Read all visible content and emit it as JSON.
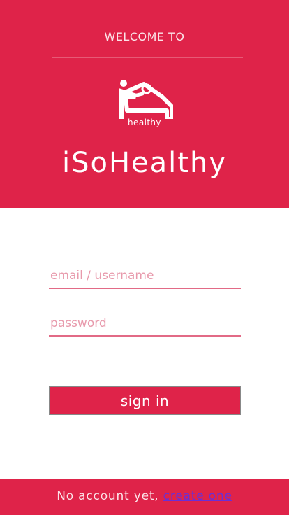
{
  "header": {
    "welcome_text": "WELCOME TO",
    "logo_text": "healthy",
    "app_name": "iSoHealthy"
  },
  "form": {
    "email_placeholder": "email / username",
    "email_value": "",
    "password_placeholder": "password",
    "password_value": "",
    "signin_label": "sign in"
  },
  "footer": {
    "prompt": "No account yet, ",
    "link_label": "create one"
  },
  "colors": {
    "brand": "#df2349",
    "link": "#6a2fd6",
    "field_underline": "#e26a86"
  }
}
